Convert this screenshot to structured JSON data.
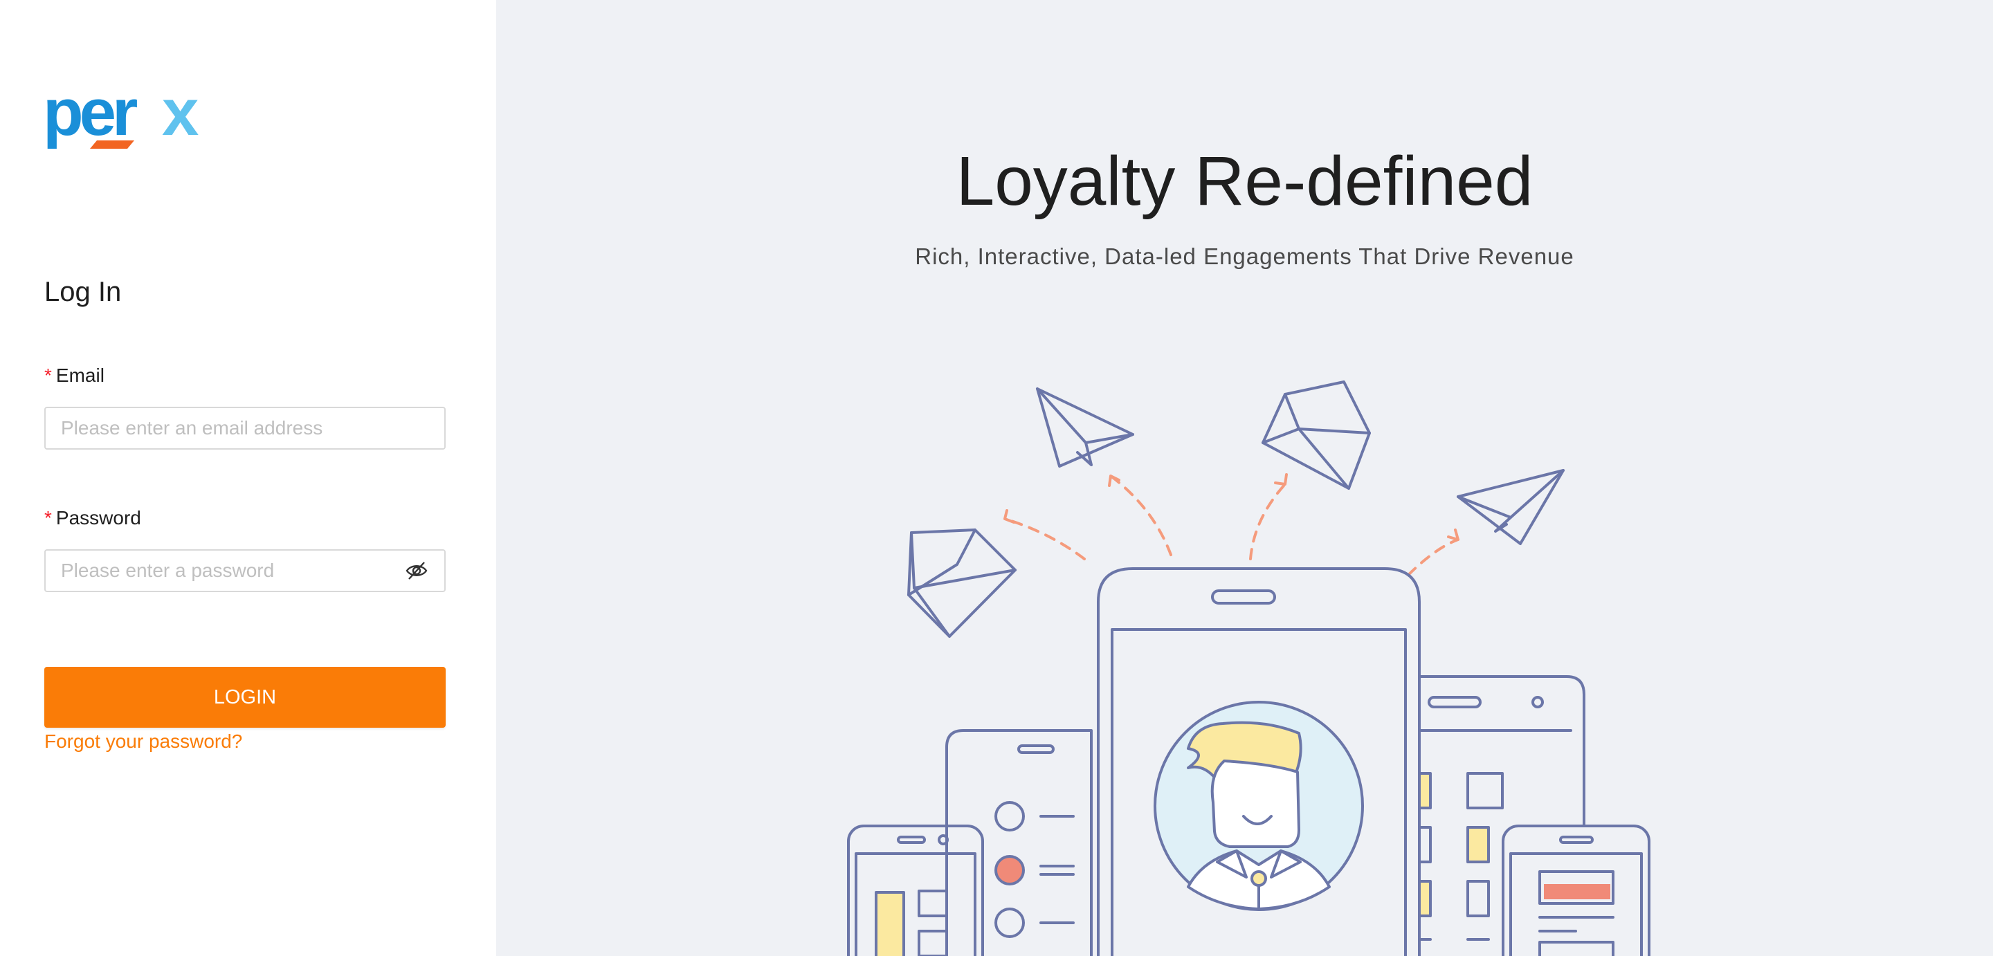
{
  "brand": {
    "logo_text": "perx",
    "colors": {
      "blue": "#1a8fd8",
      "light_blue": "#5fc2ee",
      "orange": "#f26522"
    }
  },
  "login": {
    "title": "Log In",
    "email": {
      "label": "Email",
      "required_mark": "*",
      "placeholder": "Please enter an email address",
      "value": ""
    },
    "password": {
      "label": "Password",
      "required_mark": "*",
      "placeholder": "Please enter a password",
      "value": "",
      "toggle_icon": "eye-hidden-icon"
    },
    "submit_label": "LOGIN",
    "forgot_label": "Forgot your password?"
  },
  "hero": {
    "title": "Loyalty Re-defined",
    "subtitle": "Rich, Interactive, Data-led Engagements That Drive Revenue"
  },
  "colors": {
    "accent": "#fa7c07",
    "left_background": "#ffffff",
    "right_background": "#eff1f5",
    "illustration_stroke": "#6b76a8",
    "illustration_dash": "#f59b7c",
    "illustration_yellow": "#fbe9a0",
    "illustration_red": "#f08a78",
    "illustration_avatar_bg": "#dff0f7"
  }
}
